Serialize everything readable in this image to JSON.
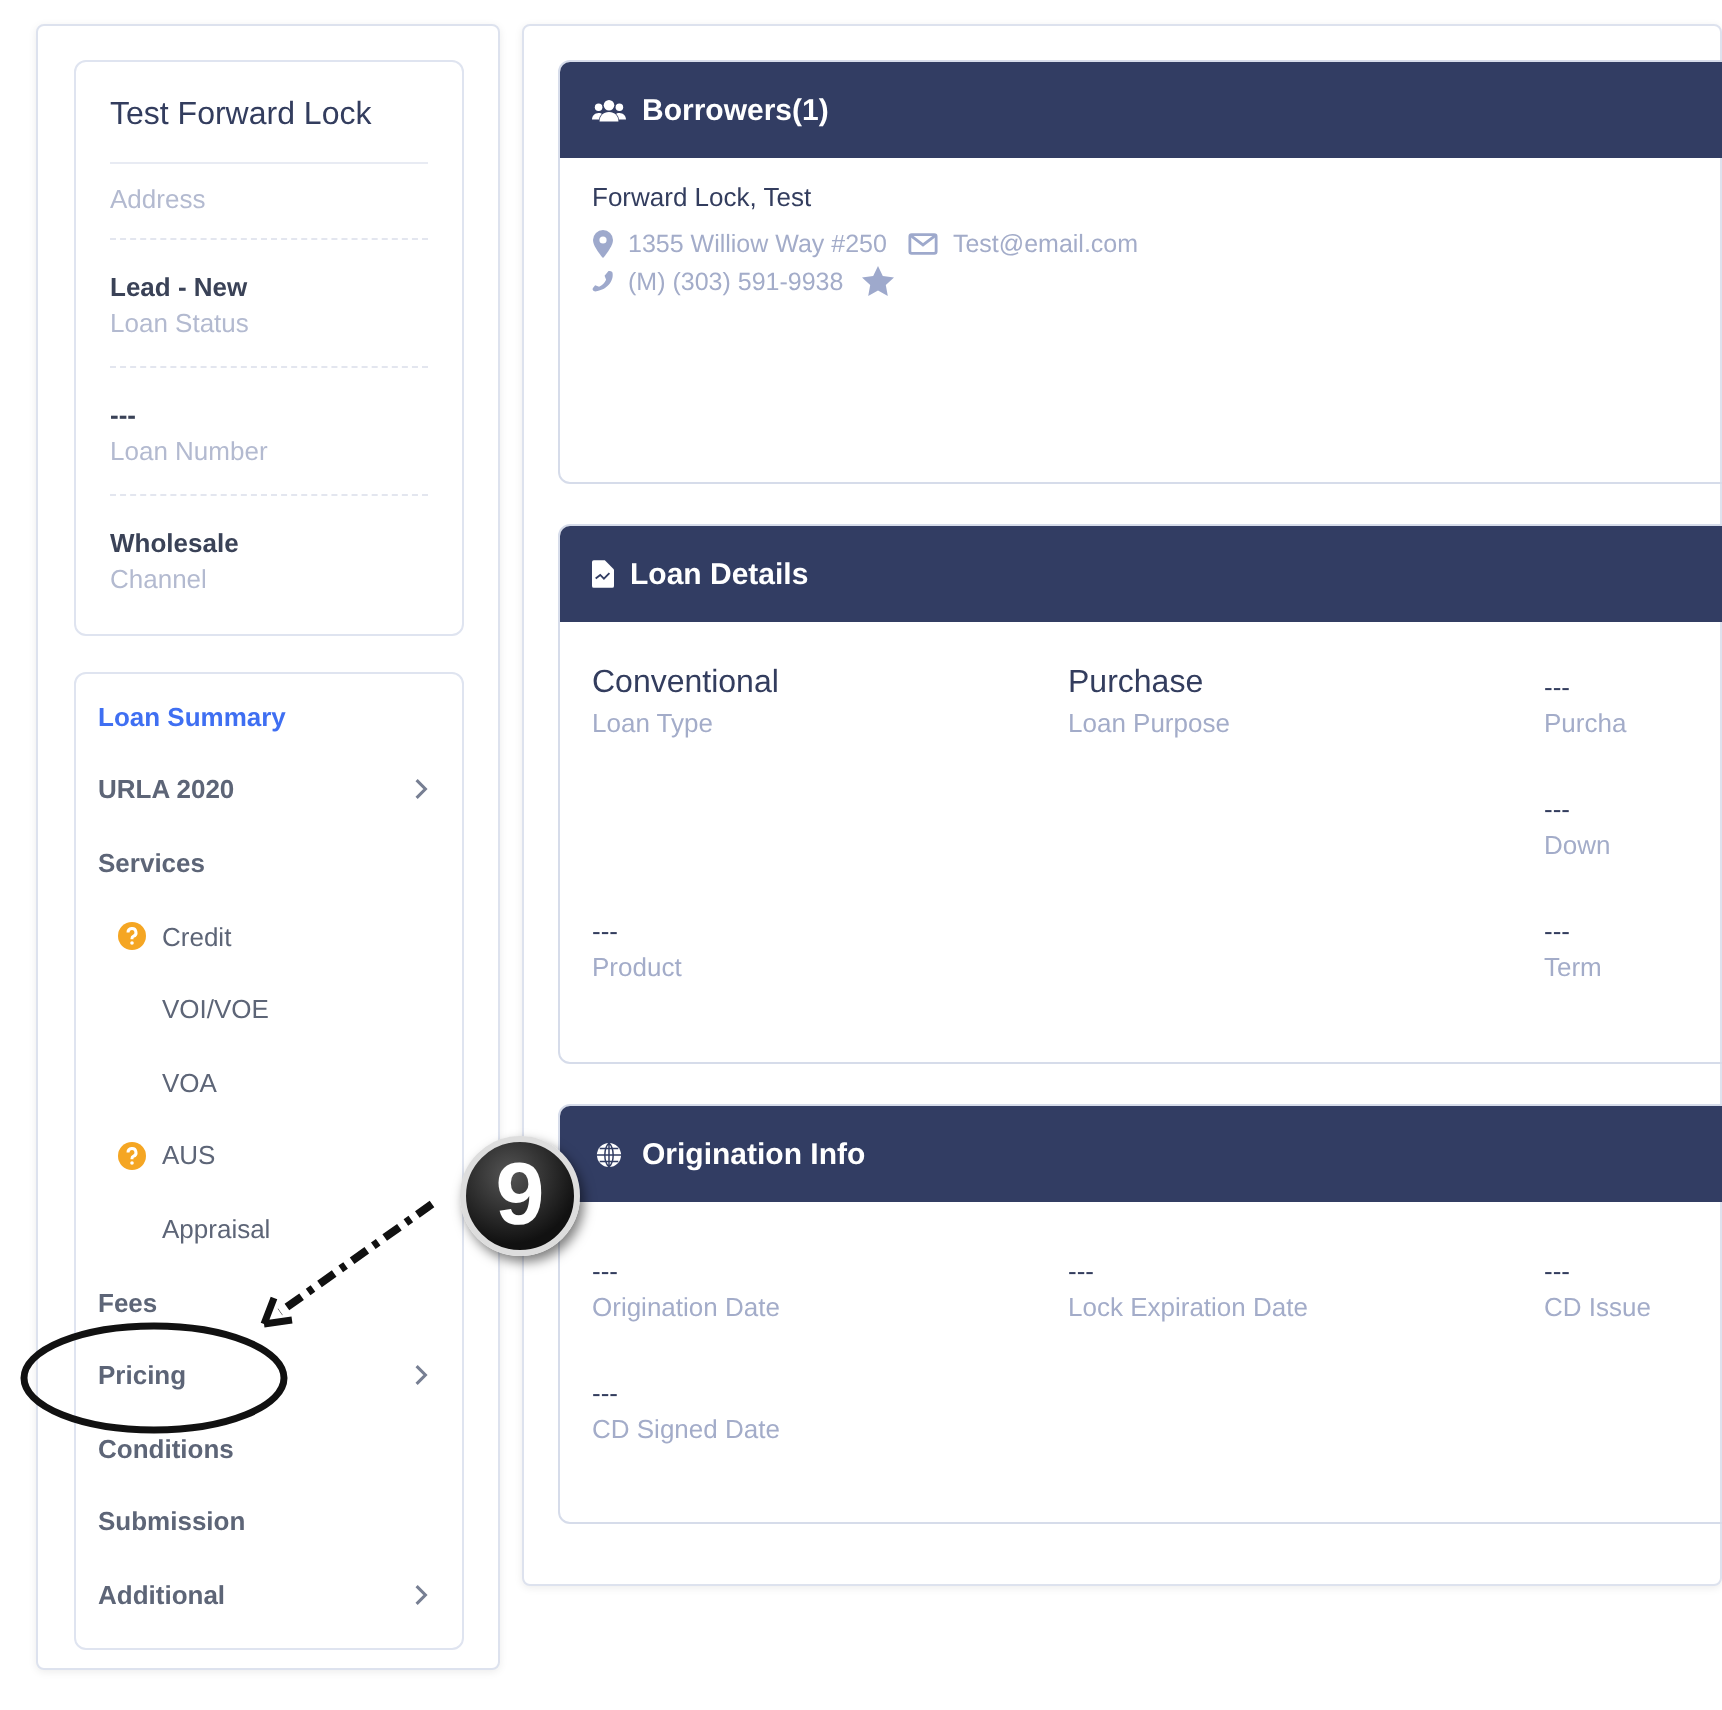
{
  "summary_card": {
    "title": "Test Forward Lock",
    "fields": [
      {
        "label": "Address"
      },
      {
        "value": "Lead - New",
        "label": "Loan Status"
      },
      {
        "value": "---",
        "label": "Loan Number"
      },
      {
        "value": "Wholesale",
        "label": "Channel"
      }
    ]
  },
  "nav": [
    {
      "label": "Loan Summary",
      "kind": "section",
      "selected": true,
      "has_children": false
    },
    {
      "label": "URLA 2020",
      "kind": "section",
      "selected": false,
      "has_children": true
    },
    {
      "label": "Services",
      "kind": "section",
      "selected": false,
      "has_children": false
    },
    {
      "label": "Credit",
      "kind": "sub",
      "selected": false,
      "warning": true
    },
    {
      "label": "VOI/VOE",
      "kind": "sub",
      "selected": false,
      "warning": false
    },
    {
      "label": "VOA",
      "kind": "sub",
      "selected": false,
      "warning": false
    },
    {
      "label": "AUS",
      "kind": "sub",
      "selected": false,
      "warning": true
    },
    {
      "label": "Appraisal",
      "kind": "sub",
      "selected": false,
      "warning": false
    },
    {
      "label": "Fees",
      "kind": "section",
      "selected": false,
      "has_children": false
    },
    {
      "label": "Pricing",
      "kind": "section",
      "selected": false,
      "has_children": true
    },
    {
      "label": "Conditions",
      "kind": "section",
      "selected": false,
      "has_children": false
    },
    {
      "label": "Submission",
      "kind": "section",
      "selected": false,
      "has_children": false
    },
    {
      "label": "Additional",
      "kind": "section",
      "selected": false,
      "has_children": true
    }
  ],
  "borrowers": {
    "title": "Borrowers(1)",
    "name": "Forward Lock, Test",
    "address": "1355 Williow Way #250",
    "email": "Test@email.com",
    "phone": "(M) (303) 591-9938",
    "starred": true
  },
  "loan_details": {
    "title": "Loan Details",
    "fields": [
      {
        "value": "Conventional",
        "label": "Loan Type",
        "large": true
      },
      {
        "value": "Purchase",
        "label": "Loan Purpose",
        "large": true
      },
      {
        "value": "---",
        "label": "Purcha",
        "large": false
      },
      {
        "value": "---",
        "label": "Down",
        "large": false
      },
      {
        "value": "---",
        "label": "Product",
        "large": false
      },
      {
        "value": "---",
        "label": "Term",
        "large": false
      }
    ]
  },
  "origination_info": {
    "title": "Origination Info",
    "fields": [
      {
        "value": "---",
        "label": "Origination Date"
      },
      {
        "value": "---",
        "label": "Lock Expiration Date"
      },
      {
        "value": "---",
        "label": "CD Issue"
      },
      {
        "value": "---",
        "label": "CD Signed Date"
      }
    ]
  },
  "callout": {
    "number": "9"
  }
}
